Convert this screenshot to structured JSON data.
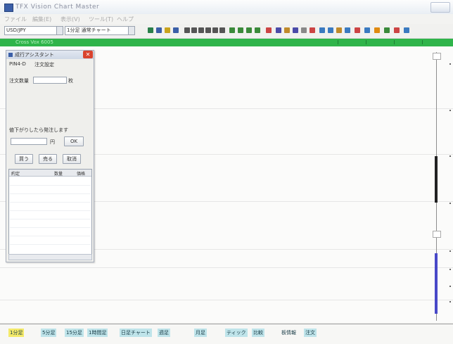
{
  "window": {
    "title": "TFX Vision Chart Master"
  },
  "menu": [
    "ファイル",
    "編集(E)",
    "表示(V)",
    "ツール(T)",
    "ヘルプ"
  ],
  "toolbar": {
    "symbol_combo": "USD/JPY",
    "timeframe_combo": "1分足 通常チャート"
  },
  "greenbar": {
    "label": "Cross Vox 6005"
  },
  "panel": {
    "title": "成行アシスタント",
    "row1_label": "PIN4-D",
    "row1_value": "注文設定",
    "row2_label": "注文数量",
    "row2_unit": "枚",
    "text_line": "値下がりしたら発注します",
    "price_unit": "円",
    "confirm_button": "OK",
    "buy_button": "買う",
    "sell_button": "売る",
    "cancel_button": "取消",
    "table_headers": [
      "約定",
      "数量",
      "価格"
    ]
  },
  "status_tabs": [
    {
      "label": "1分足",
      "color": "#f4ea6a"
    },
    {
      "label": "5分足",
      "color": "#bfe4ea"
    },
    {
      "label": "15分足",
      "color": "#bfe4ea"
    },
    {
      "label": "1時間足",
      "color": "#bfe4ea"
    },
    {
      "label": "日足チャート",
      "color": "#bfe4ea"
    },
    {
      "label": "週足",
      "color": "#bfe4ea"
    },
    {
      "label": "月足",
      "color": "#bfe4ea"
    },
    {
      "label": "ティック",
      "color": "#bfe4ea"
    },
    {
      "label": "比較",
      "color": "#bfe4ea"
    },
    {
      "label": "板情報",
      "color": "#f7f7f5"
    },
    {
      "label": "注文",
      "color": "#bfe4ea"
    }
  ],
  "colors": {
    "accent_green": "#2fb44a",
    "blue_bar": "#4848c8",
    "tab_cyan": "#bfe4ea",
    "tab_yellow": "#f4ea6a"
  }
}
